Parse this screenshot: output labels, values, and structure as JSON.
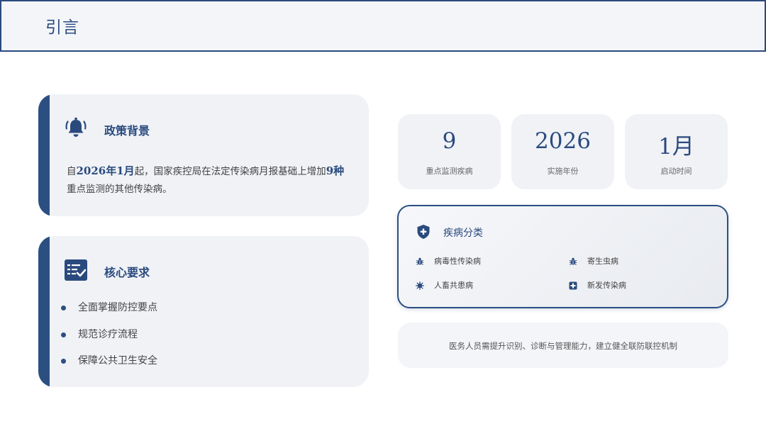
{
  "header": {
    "title": "引言"
  },
  "policy": {
    "title": "政策背景",
    "text_prefix": "自",
    "text_date": "2026年1月",
    "text_middle": "起，国家疾控局在法定传染病月报基础上增加",
    "text_count": "9种",
    "text_suffix": "重点监测的其他传染病。",
    "icon": "bell-icon"
  },
  "core": {
    "title": "核心要求",
    "icon": "checklist-icon",
    "items": [
      "全面掌握防控要点",
      "规范诊疗流程",
      "保障公共卫生安全"
    ]
  },
  "stats": [
    {
      "value": "9",
      "label": "重点监测疾病"
    },
    {
      "value": "2026",
      "label": "实施年份"
    },
    {
      "value": "1月",
      "label": "启动时间"
    }
  ],
  "categories": {
    "title": "疾病分类",
    "icon": "shield-plus-icon",
    "items": [
      {
        "label": "病毒性传染病",
        "icon": "bug-icon"
      },
      {
        "label": "寄生虫病",
        "icon": "bug-icon"
      },
      {
        "label": "人畜共患病",
        "icon": "virus-icon"
      },
      {
        "label": "新发传染病",
        "icon": "medical-cross-icon"
      }
    ]
  },
  "note": {
    "text": "医务人员需提升识别、诊断与管理能力，建立健全联防联控机制"
  },
  "colors": {
    "primary": "#2a4a7e",
    "card_bg": "#f0f2f6"
  }
}
